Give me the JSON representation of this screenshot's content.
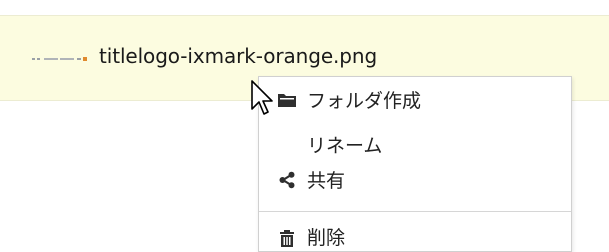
{
  "file": {
    "name": "titlelogo-ixmark-orange.png"
  },
  "context_menu": {
    "items": [
      {
        "label": "フォルダ作成",
        "icon": "folder-icon"
      },
      {
        "label": "リネーム",
        "icon": ""
      },
      {
        "label": "共有",
        "icon": "share-icon"
      },
      {
        "label": "削除",
        "icon": "trash-icon"
      }
    ]
  },
  "colors": {
    "row_highlight": "#fcfce0",
    "menu_border": "#d0d0d0",
    "text": "#222222"
  }
}
